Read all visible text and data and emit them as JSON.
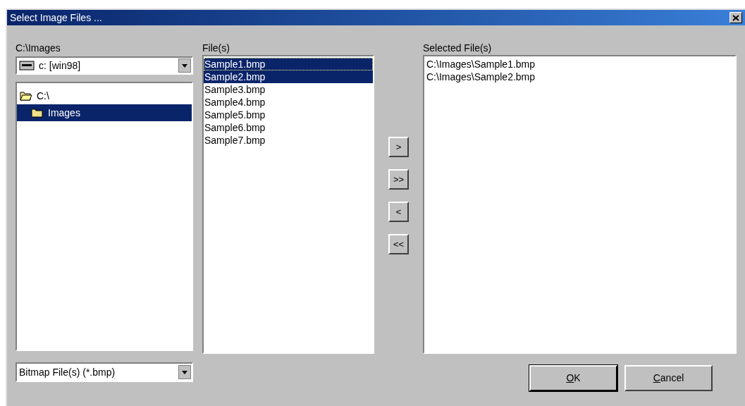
{
  "window": {
    "title": "Select Image Files ..."
  },
  "folder_label": "C:\\Images",
  "drive": {
    "value": "c: [win98]"
  },
  "tree": [
    {
      "label": "C:\\",
      "selected": false,
      "expanded": true,
      "children": [
        {
          "label": "Images",
          "selected": true,
          "expanded": false
        }
      ]
    }
  ],
  "files_label": "File(s)",
  "files": [
    {
      "name": "Sample1.bmp",
      "selected": true,
      "focused": true
    },
    {
      "name": "Sample2.bmp",
      "selected": true,
      "focused": false
    },
    {
      "name": "Sample3.bmp",
      "selected": false,
      "focused": false
    },
    {
      "name": "Sample4.bmp",
      "selected": false,
      "focused": false
    },
    {
      "name": "Sample5.bmp",
      "selected": false,
      "focused": false
    },
    {
      "name": "Sample6.bmp",
      "selected": false,
      "focused": false
    },
    {
      "name": "Sample7.bmp",
      "selected": false,
      "focused": false
    }
  ],
  "move_buttons": [
    ">",
    ">>",
    "<",
    "<<"
  ],
  "selected_label": "Selected File(s)",
  "selected_files": [
    "C:\\Images\\Sample1.bmp",
    "C:\\Images\\Sample2.bmp"
  ],
  "filter": {
    "value": "Bitmap File(s) (*.bmp)"
  },
  "buttons": [
    "OK",
    "Cancel"
  ]
}
